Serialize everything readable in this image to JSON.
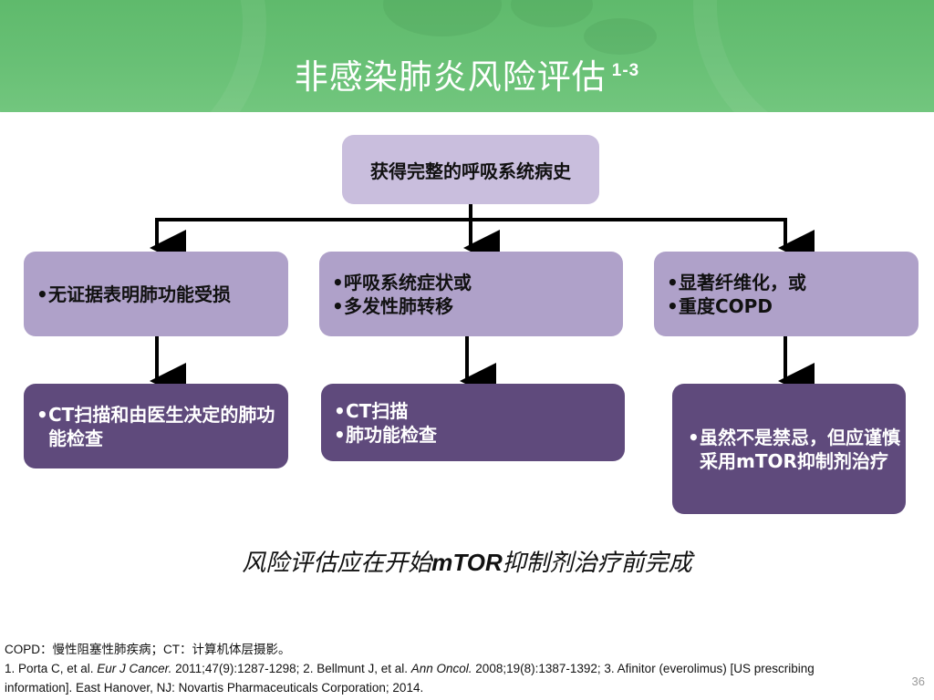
{
  "header": {
    "title": "非感染肺炎风险评估",
    "title_superscript": "1-3",
    "color": "#68c075"
  },
  "flow": {
    "root": "获得完整的呼吸系统病史",
    "branches": [
      {
        "condition": [
          "无证据表明肺功能受损"
        ],
        "action": [
          "CT扫描和由医生决定的肺功能检查"
        ]
      },
      {
        "condition": [
          "呼吸系统症状或",
          "多发性肺转移"
        ],
        "action": [
          "CT扫描",
          "肺功能检查"
        ]
      },
      {
        "condition": [
          "显著纤维化，或",
          "重度COPD"
        ],
        "action": [
          "虽然不是禁忌，但应谨慎采用mTOR抑制剂治疗"
        ]
      }
    ],
    "colors": {
      "root": "#c9bedd",
      "condition": "#afa1c9",
      "action": "#5f4a7c"
    }
  },
  "conclusion": {
    "before": "风险评估应在开始",
    "emphasis": "mTOR",
    "after": "抑制剂治疗前完成"
  },
  "footnotes": {
    "abbreviations": "COPD：慢性阻塞性肺疾病；CT：计算机体层摄影。",
    "ref1_a": "1. Porta C, et al. ",
    "ref1_journal": "Eur J Cancer.",
    "ref1_b": " 2011;47(9):1287-1298; 2. Bellmunt J, et al. ",
    "ref2_journal": "Ann Oncol.",
    "ref2_b": " 2008;19(8):1387-1392; 3. Afinitor (everolimus) [US prescribing information]. East Hanover, NJ: Novartis Pharmaceuticals Corporation; 2014."
  },
  "page_number": "36"
}
